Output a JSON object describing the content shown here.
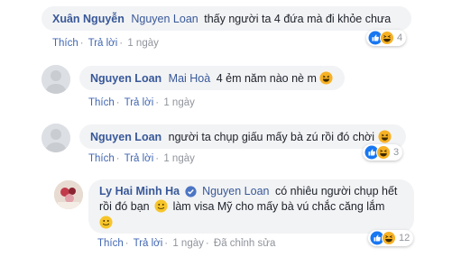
{
  "comments": [
    {
      "author": "Xuân Nguyễn",
      "mention": "Nguyen Loan",
      "text": "thấy người ta 4 đứa mà đi khỏe chưa",
      "actions": {
        "like": "Thích",
        "reply": "Trả lời",
        "time": "1 ngày"
      },
      "reaction_count": "4"
    },
    {
      "author": "Nguyen Loan",
      "mention": "Mai Hoà",
      "text": "4 ẻm năm nào nè m",
      "actions": {
        "like": "Thích",
        "reply": "Trả lời",
        "time": "1 ngày"
      }
    },
    {
      "author": "Nguyen Loan",
      "text": "người ta chụp giấu mấy bà zú rồi đó chời",
      "actions": {
        "like": "Thích",
        "reply": "Trả lời",
        "time": "1 ngày"
      },
      "reaction_count": "3"
    },
    {
      "author": "Ly Hai Minh Ha",
      "mention": "Nguyen Loan",
      "text_line1": "có nhiêu người chụp hết",
      "text_line2a": "rồi đó bạn",
      "text_line2b": "làm visa Mỹ cho mấy bà vú chắc căng lắm",
      "actions": {
        "like": "Thích",
        "reply": "Trả lời",
        "time": "1 ngày",
        "edited": "Đã chỉnh sửa"
      },
      "reaction_count": "12"
    }
  ],
  "colors": {
    "name": "#385898",
    "link": "#4267b2",
    "meta": "#90949c",
    "bubble": "#f2f3f5",
    "like": "#1877f2",
    "haha": "#f7b125"
  },
  "icons": [
    "like-icon",
    "haha-icon",
    "smile-icon",
    "verified-icon",
    "avatar-placeholder"
  ]
}
